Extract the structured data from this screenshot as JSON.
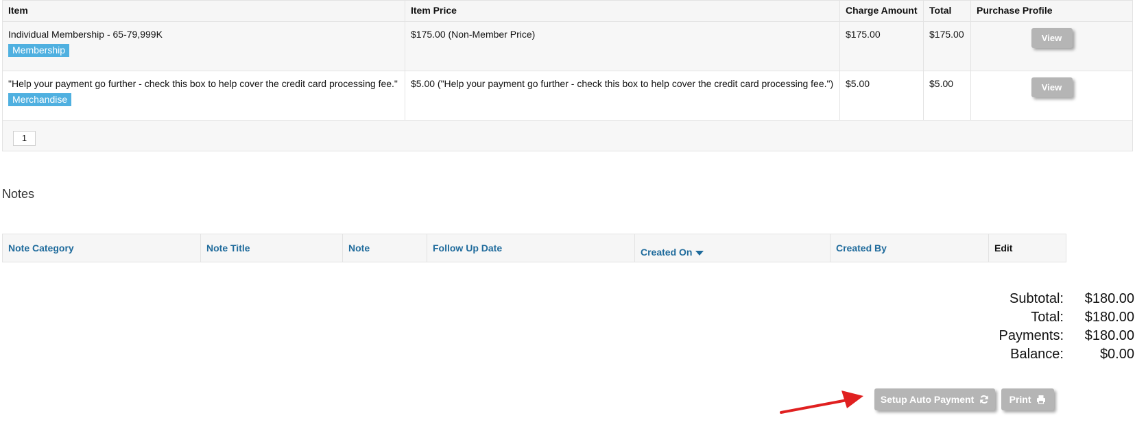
{
  "items_table": {
    "columns": [
      "Item",
      "Item Price",
      "Charge Amount",
      "Total",
      "Purchase Profile"
    ],
    "rows": [
      {
        "item": "Individual Membership - 65-79,999K",
        "tag": "Membership",
        "price": "$175.00 (Non-Member Price)",
        "charge": "$175.00",
        "total": "$175.00",
        "action": "View"
      },
      {
        "item": "\"Help your payment go further - check this box to help cover the credit card processing fee.\"",
        "tag": "Merchandise",
        "price": "$5.00 (\"Help your payment go further - check this box to help cover the credit card processing fee.\")",
        "charge": "$5.00",
        "total": "$5.00",
        "action": "View"
      }
    ],
    "pager": {
      "page": "1"
    }
  },
  "notes": {
    "heading": "Notes",
    "columns": [
      "Note Category",
      "Note Title",
      "Note",
      "Follow Up Date",
      "Created On",
      "Created By",
      "Edit"
    ]
  },
  "totals": {
    "subtotal_label": "Subtotal:",
    "subtotal": "$180.00",
    "total_label": "Total:",
    "total": "$180.00",
    "payments_label": "Payments:",
    "payments": "$180.00",
    "balance_label": "Balance:",
    "balance": "$0.00"
  },
  "actions": {
    "setup_auto_payment": "Setup Auto Payment",
    "print": "Print"
  },
  "colors": {
    "tag_bg": "#4fb0e0",
    "link": "#1f6b9c",
    "button_bg": "#b5b5b5",
    "arrow": "#e02020"
  },
  "icons": {
    "sort": "caret-down-icon",
    "refresh": "refresh-icon",
    "print": "printer-icon",
    "annotation": "red-arrow-icon"
  }
}
